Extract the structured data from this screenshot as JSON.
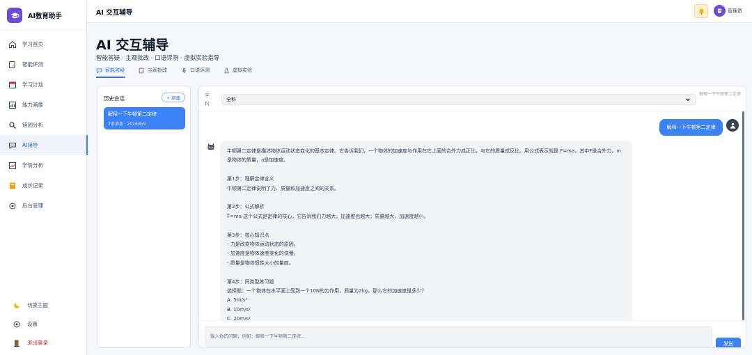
{
  "app": {
    "name": "AI教育助手"
  },
  "sidebar": {
    "items": [
      {
        "label": "学习首页",
        "icon": "home-icon",
        "active": false
      },
      {
        "label": "智能评测",
        "icon": "edit-icon",
        "active": false
      },
      {
        "label": "学习计划",
        "icon": "calendar-icon",
        "active": false
      },
      {
        "label": "能力画像",
        "icon": "bar-chart-icon",
        "active": false
      },
      {
        "label": "错因分析",
        "icon": "search-icon",
        "active": false
      },
      {
        "label": "AI辅导",
        "icon": "chat-icon",
        "active": true
      },
      {
        "label": "学情分析",
        "icon": "trend-icon",
        "active": false
      },
      {
        "label": "成长记录",
        "icon": "notebook-icon",
        "active": false
      },
      {
        "label": "后台管理",
        "icon": "gear-icon",
        "active": false
      }
    ],
    "bottom": [
      {
        "label": "切换主题",
        "icon": "moon-icon"
      },
      {
        "label": "设置",
        "icon": "gear-icon"
      },
      {
        "label": "退出登录",
        "icon": "door-icon"
      }
    ]
  },
  "topbar": {
    "title": "AI 交互辅导",
    "user_name": "管理员"
  },
  "page": {
    "title": "AI 交互辅导",
    "subtitle": "智能答疑 · 主观批改 · 口语评测 · 虚拟实验指导",
    "tabs": [
      {
        "label": "智能答疑",
        "icon": "chat-icon",
        "active": true
      },
      {
        "label": "主观批改",
        "icon": "edit-icon",
        "active": false
      },
      {
        "label": "口语评测",
        "icon": "mic-icon",
        "active": false
      },
      {
        "label": "虚拟实验",
        "icon": "flask-icon",
        "active": false
      }
    ]
  },
  "history": {
    "title": "历史会话",
    "new_label": "+ 新建",
    "sessions": [
      {
        "title": "解释一下牛顿第二定律",
        "meta": "2条消息 · 2026/8/9"
      }
    ]
  },
  "chat": {
    "subject_label": "学科:",
    "subject_value": "全科",
    "topic_hint": "解释一下牛顿第二定律",
    "user_message": "解释一下牛顿第二定律",
    "bot_lines": [
      "牛顿第二定律是描述物体运动状态变化的基本定律。它告诉我们，一个物体的加速度与作用在它上面的合外力成正比，与它的质量成反比。用公式表示就是 F=ma，其中F是合外力，m是物体的质量，a是加速度。",
      "",
      "第1步：理解定律含义",
      "牛顿第二定律说明了力、质量和加速度之间的关系。",
      "",
      "第2步：公式解析",
      "F=ma 这个公式是定律的核心，它告诉我们力越大，加速度也越大；质量越大，加速度越小。",
      "",
      "第3步：核心知识点",
      "- 力是改变物体运动状态的原因。",
      "- 加速度是物体速度变化的快慢。",
      "- 质量是物体惯性大小的量度。",
      "",
      "第4步：同类型练习题",
      "选择题：一个物体在水平面上受到一个10N的力作用，质量为2kg，那么它的加速度是多少？",
      "A. 5m/s²",
      "B. 10m/s²",
      "C. 20m/s²"
    ],
    "input_placeholder": "输入你的问题，例如：解释一下牛顿第二定律...",
    "send_label": "发送"
  },
  "colors": {
    "accent": "#3b82f6",
    "brand": "#6b4bd8",
    "logout": "#dc2626"
  }
}
